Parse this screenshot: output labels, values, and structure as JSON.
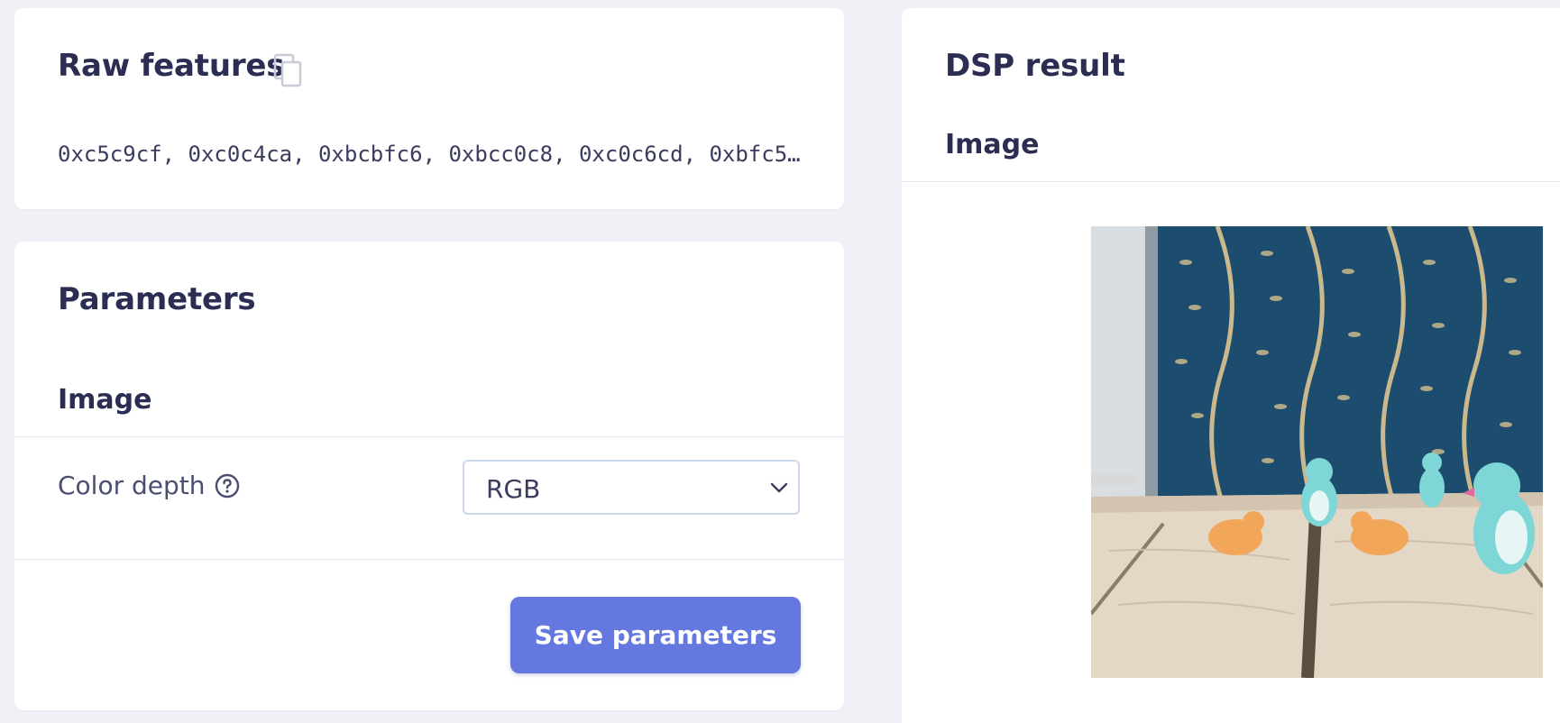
{
  "raw_features": {
    "title": "Raw features",
    "values_text": "0xc5c9cf, 0xc0c4ca, 0xbcbfc6, 0xbcc0c8, 0xc0c6cd, 0xbfc5…",
    "copy_icon": "copy-icon"
  },
  "parameters": {
    "title": "Parameters",
    "section_title": "Image",
    "color_depth_label": "Color depth",
    "help_icon": "question-circle-icon",
    "color_depth_value": "RGB",
    "save_label": "Save parameters"
  },
  "dsp_result": {
    "title": "DSP result",
    "section_title": "Image"
  },
  "colors": {
    "page_bg": "#f0f1f6",
    "card_bg": "#ffffff",
    "text_primary": "#2b2d52",
    "accent": "#6478e0"
  }
}
